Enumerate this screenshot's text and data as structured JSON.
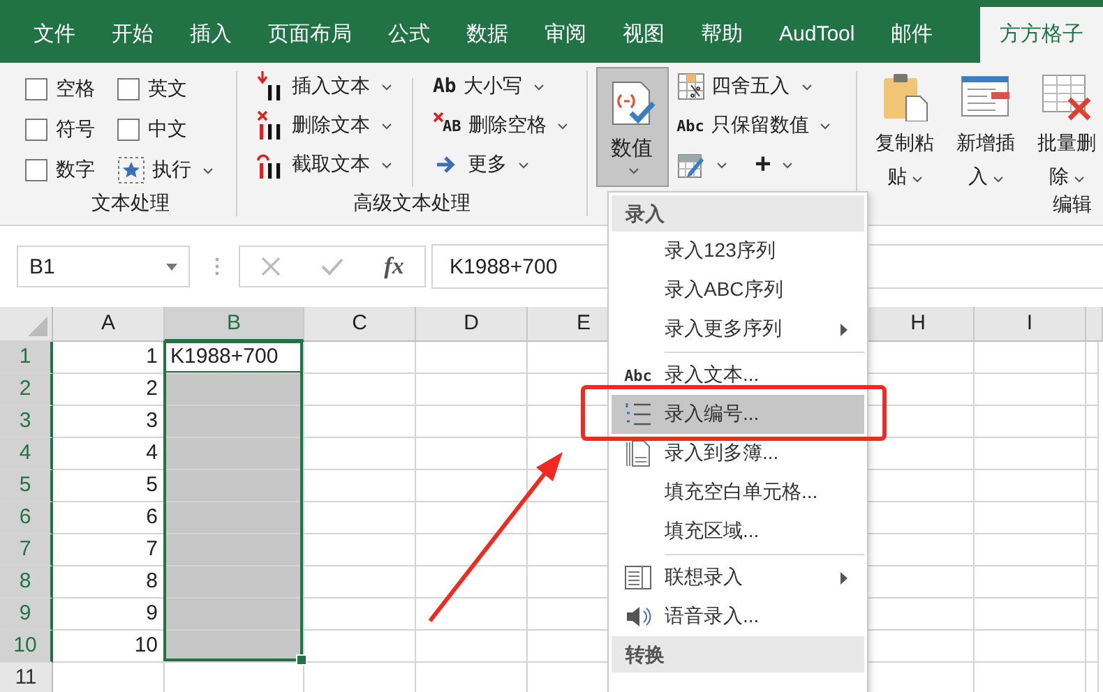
{
  "tabs": [
    {
      "label": "文件",
      "selected": false
    },
    {
      "label": "开始",
      "selected": false
    },
    {
      "label": "插入",
      "selected": false
    },
    {
      "label": "页面布局",
      "selected": false
    },
    {
      "label": "公式",
      "selected": false
    },
    {
      "label": "数据",
      "selected": false
    },
    {
      "label": "审阅",
      "selected": false
    },
    {
      "label": "视图",
      "selected": false
    },
    {
      "label": "帮助",
      "selected": false
    },
    {
      "label": "AudTool",
      "selected": false
    },
    {
      "label": "邮件",
      "selected": false
    },
    {
      "label": "方方格子",
      "selected": true
    }
  ],
  "text_group": {
    "label": "文本处理",
    "checkboxes": [
      {
        "label": "空格",
        "checked": false
      },
      {
        "label": "英文",
        "checked": false
      },
      {
        "label": "符号",
        "checked": false
      },
      {
        "label": "中文",
        "checked": false
      },
      {
        "label": "数字",
        "checked": false
      }
    ],
    "run_button": "执行"
  },
  "advanced_group": {
    "label": "高级文本处理",
    "left": [
      "插入文本",
      "删除文本",
      "截取文本"
    ],
    "right": [
      {
        "icon_text": "Ab",
        "label": "大小写"
      },
      {
        "icon_text": "AB",
        "label": "删除空格"
      },
      {
        "label": "更多"
      }
    ]
  },
  "number_group": {
    "big_button": {
      "label": "数值",
      "pressed": true
    },
    "items": [
      {
        "label": "四舍五入"
      },
      {
        "icon_text": "Abc",
        "label": "只保留数值"
      }
    ],
    "extra": "+"
  },
  "edit_group": {
    "label": "编辑",
    "buttons": [
      "复制粘贴",
      "新增插入",
      "批量删除"
    ]
  },
  "formula_bar": {
    "name_box": "B1",
    "fx": "fx",
    "formula": "K1988+700"
  },
  "sheet": {
    "columns": [
      {
        "label": "A",
        "selected": false
      },
      {
        "label": "B",
        "selected": true
      },
      {
        "label": "C",
        "selected": false
      },
      {
        "label": "D",
        "selected": false
      },
      {
        "label": "E",
        "selected": false
      },
      {
        "label": "H",
        "selected": false
      },
      {
        "label": "I",
        "selected": false
      }
    ],
    "rows": [
      {
        "header": "1",
        "a": "1",
        "b": "K1988+700",
        "selected": true,
        "active": true
      },
      {
        "header": "2",
        "a": "2",
        "selected": true,
        "active": false
      },
      {
        "header": "3",
        "a": "3",
        "selected": true,
        "active": false
      },
      {
        "header": "4",
        "a": "4",
        "selected": true,
        "active": false
      },
      {
        "header": "5",
        "a": "5",
        "selected": true,
        "active": false
      },
      {
        "header": "6",
        "a": "6",
        "selected": true,
        "active": false
      },
      {
        "header": "7",
        "a": "7",
        "selected": true,
        "active": false
      },
      {
        "header": "8",
        "a": "8",
        "selected": true,
        "active": false
      },
      {
        "header": "9",
        "a": "9",
        "selected": true,
        "active": false
      },
      {
        "header": "10",
        "a": "10",
        "selected": true,
        "active": false
      },
      {
        "header": "11",
        "selected": false,
        "active": false
      }
    ]
  },
  "menu": {
    "items": [
      {
        "kind": "header",
        "label": "录入"
      },
      {
        "kind": "item",
        "label": "录入123序列",
        "submenu": false,
        "selected": false
      },
      {
        "kind": "item",
        "label": "录入ABC序列",
        "submenu": false,
        "selected": false
      },
      {
        "kind": "item",
        "label": "录入更多序列",
        "submenu": true,
        "selected": false
      },
      {
        "kind": "separator"
      },
      {
        "kind": "item",
        "icon_text": "Abc",
        "label": "录入文本...",
        "submenu": false,
        "selected": false
      },
      {
        "kind": "item",
        "label": "录入编号...",
        "submenu": false,
        "selected": true
      },
      {
        "kind": "item",
        "label": "录入到多簿...",
        "submenu": false,
        "selected": false
      },
      {
        "kind": "item",
        "label": "填充空白单元格...",
        "submenu": false,
        "selected": false
      },
      {
        "kind": "item",
        "label": "填充区域...",
        "submenu": false,
        "selected": false
      },
      {
        "kind": "separator"
      },
      {
        "kind": "item",
        "label": "联想录入",
        "submenu": true,
        "selected": false
      },
      {
        "kind": "item",
        "label": "语音录入...",
        "submenu": false,
        "selected": false
      },
      {
        "kind": "header",
        "label": "转换"
      }
    ]
  }
}
